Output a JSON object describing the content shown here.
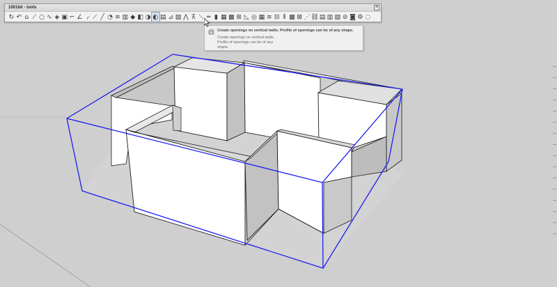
{
  "window": {
    "title": "1001bit - tools",
    "close_label": "×"
  },
  "toolbar": {
    "tools": [
      {
        "name": "rotate-tool-icon",
        "glyph": "↻"
      },
      {
        "name": "arc-tool-icon",
        "glyph": "↶"
      },
      {
        "name": "stairs-tool-icon",
        "glyph": "⌂"
      },
      {
        "name": "measure-tool-icon",
        "glyph": "⟋"
      },
      {
        "name": "circle-tool-icon",
        "glyph": "○"
      },
      {
        "name": "curve-tool-icon",
        "glyph": "∿"
      },
      {
        "name": "cube-tool-icon",
        "glyph": "◈"
      },
      {
        "name": "box-tool-icon",
        "glyph": "▣"
      },
      {
        "name": "corner-tool-icon",
        "glyph": "⌐"
      },
      {
        "name": "angle-tool-icon",
        "glyph": "∠"
      },
      {
        "name": "frame-tool-icon",
        "glyph": "⌌"
      },
      {
        "name": "slope-tool-icon",
        "glyph": "⟋"
      },
      {
        "name": "line-tool-icon",
        "glyph": "╱"
      },
      {
        "name": "paint-tool-icon",
        "glyph": "◔"
      },
      {
        "name": "layer-tool-icon",
        "glyph": "≋"
      },
      {
        "name": "wall-tool-icon",
        "glyph": "▥"
      },
      {
        "name": "node-tool-icon",
        "glyph": "◆"
      },
      {
        "name": "solid-tool-icon",
        "glyph": "◧"
      },
      {
        "name": "disc-tool-icon",
        "glyph": "◑"
      },
      {
        "name": "opening-tool-icon",
        "glyph": "◐"
      },
      {
        "name": "window-tool-icon",
        "glyph": "▤"
      },
      {
        "name": "door-tool-icon",
        "glyph": "⊿"
      },
      {
        "name": "hatch-tool-icon",
        "glyph": "▨"
      },
      {
        "name": "roof-tool-icon",
        "glyph": "⋀"
      },
      {
        "name": "truss-tool-icon",
        "glyph": "⊼"
      },
      {
        "name": "rafter-tool-icon",
        "glyph": "⟍"
      },
      {
        "name": "beam-tool-icon",
        "glyph": "═"
      },
      {
        "name": "column-tool-icon",
        "glyph": "▮"
      },
      {
        "name": "grid-tool-icon",
        "glyph": "▦"
      },
      {
        "name": "deck-tool-icon",
        "glyph": "▩"
      },
      {
        "name": "fence-tool-icon",
        "glyph": "⊞"
      },
      {
        "name": "ramp-tool-icon",
        "glyph": "◺"
      },
      {
        "name": "spiral-tool-icon",
        "glyph": "◎"
      },
      {
        "name": "panel-tool-icon",
        "glyph": "▦"
      },
      {
        "name": "louver-tool-icon",
        "glyph": "≡"
      },
      {
        "name": "joist-tool-icon",
        "glyph": "⊟"
      },
      {
        "name": "stud-tool-icon",
        "glyph": "⦀"
      },
      {
        "name": "mesh-tool-icon",
        "glyph": "▩"
      },
      {
        "name": "array-tool-icon",
        "glyph": "⊠"
      },
      {
        "name": "path-tool-icon",
        "glyph": "⋰"
      },
      {
        "name": "chain-tool-icon",
        "glyph": "⛓"
      },
      {
        "name": "tile-tool-icon",
        "glyph": "▤"
      },
      {
        "name": "brick-tool-icon",
        "glyph": "▥"
      },
      {
        "name": "block-tool-icon",
        "glyph": "▧"
      },
      {
        "name": "split-tool-icon",
        "glyph": "⊘"
      },
      {
        "name": "texture-tool-icon",
        "glyph": "◙"
      },
      {
        "name": "settings-tool-icon",
        "glyph": "⚙"
      },
      {
        "name": "info-tool-icon",
        "glyph": "◌"
      }
    ],
    "active_index": 19
  },
  "tooltip": {
    "title": "Create openings on vertical walls. Profile of openings can be of any shape.",
    "desc_line_1": "Create openings on vertical walls.",
    "desc_line_2": "Profile of openings can be of any",
    "desc_line_3": "shape."
  },
  "colors": {
    "background": "#cfcfcf",
    "ground_line": "#9a9a9a",
    "wall_face_light": "#ffffff",
    "wall_face_shaded": "#c6c6c6",
    "wall_edge": "#1a1a1a",
    "selection_box": "#1c1cf0"
  }
}
